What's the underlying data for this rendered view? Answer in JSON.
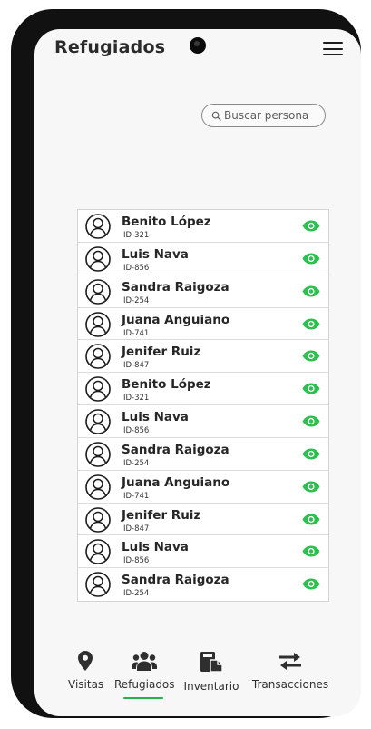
{
  "header": {
    "title": "Refugiados"
  },
  "search": {
    "placeholder": "Buscar persona"
  },
  "people": [
    {
      "name": "Benito López",
      "id": "ID-321"
    },
    {
      "name": "Luis Nava",
      "id": "ID-856"
    },
    {
      "name": "Sandra Raigoza",
      "id": "ID-254"
    },
    {
      "name": "Juana Anguiano",
      "id": "ID-741"
    },
    {
      "name": "Jenifer Ruiz",
      "id": "ID-847"
    },
    {
      "name": "Benito López",
      "id": "ID-321"
    },
    {
      "name": "Luis Nava",
      "id": "ID-856"
    },
    {
      "name": "Sandra Raigoza",
      "id": "ID-254"
    },
    {
      "name": "Juana Anguiano",
      "id": "ID-741"
    },
    {
      "name": "Jenifer Ruiz",
      "id": "ID-847"
    },
    {
      "name": "Luis Nava",
      "id": "ID-856"
    },
    {
      "name": "Sandra Raigoza",
      "id": "ID-254"
    }
  ],
  "nav": {
    "items": [
      {
        "label": "Visitas",
        "icon": "map-pin-icon"
      },
      {
        "label": "Refugiados",
        "icon": "users-icon",
        "active": true
      },
      {
        "label": "Inventario",
        "icon": "inventory-icon"
      },
      {
        "label": "Transacciones",
        "icon": "transfer-icon"
      }
    ]
  },
  "colors": {
    "accent": "#22b14c",
    "eye": "#2dbf4f",
    "frame": "#111111"
  }
}
